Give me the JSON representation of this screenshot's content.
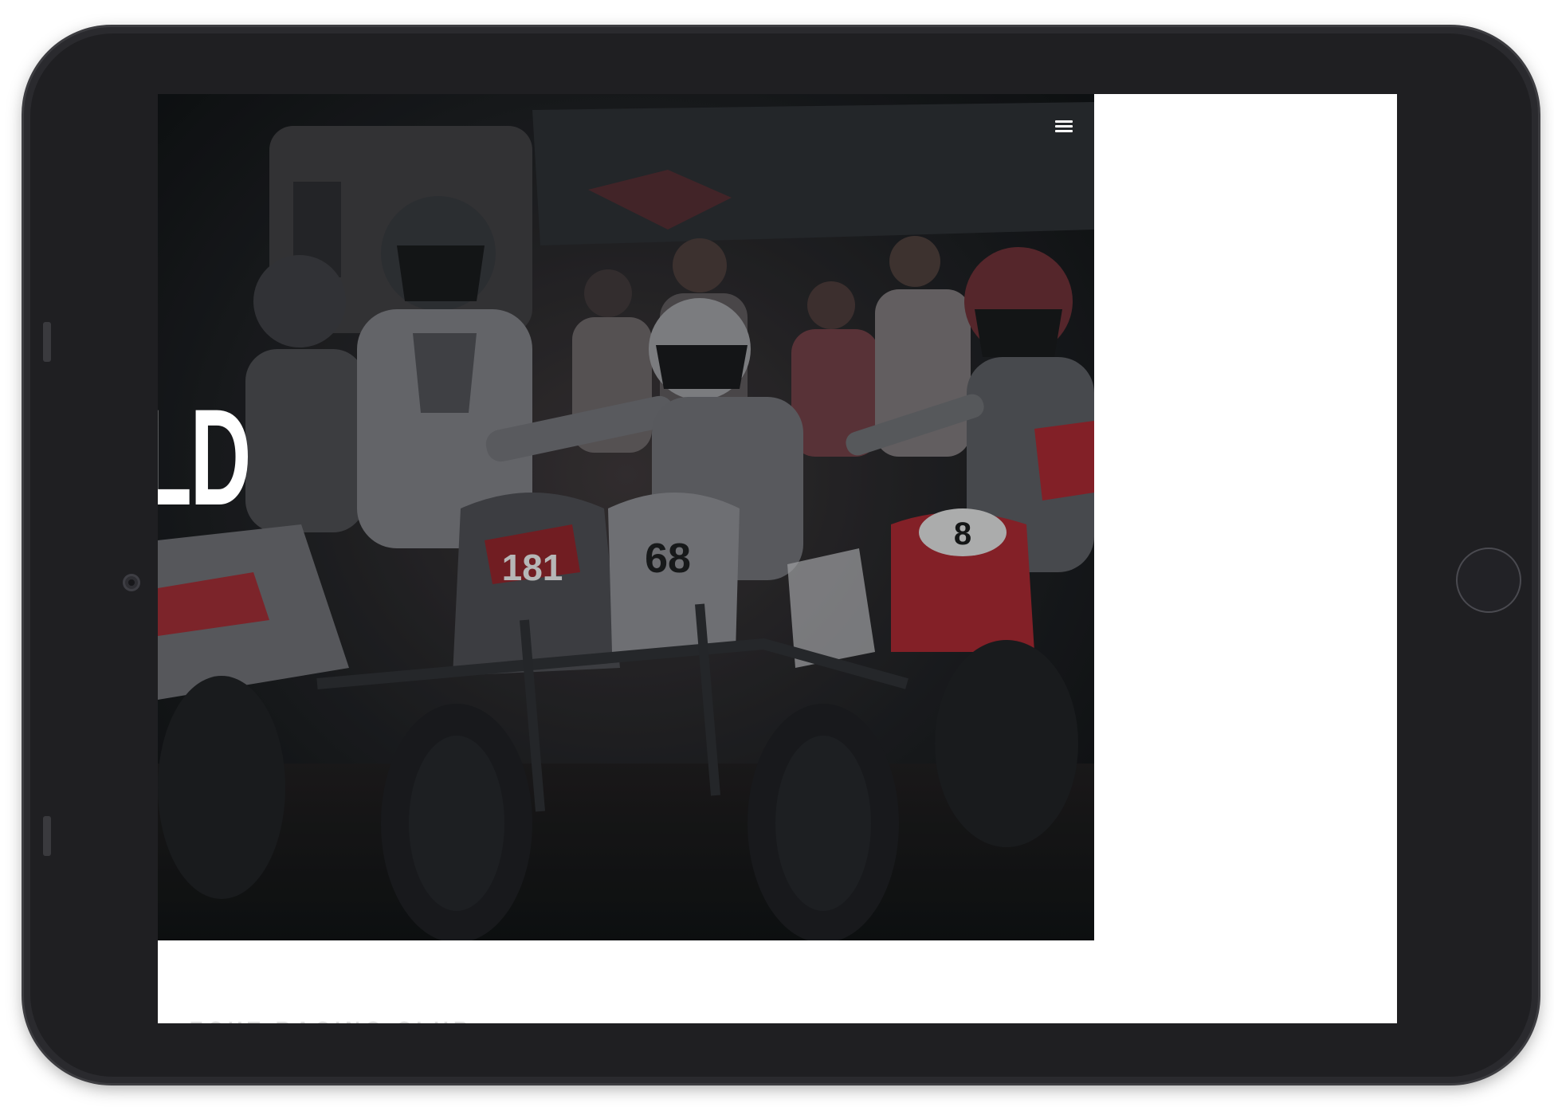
{
  "hero": {
    "title": "IELD",
    "image_description_icon": "atv-racers-photo",
    "rider_numbers": [
      "181",
      "68",
      "8"
    ]
  },
  "nav": {
    "menu_icon": "hamburger-menu-icon"
  },
  "section": {
    "label": "...ECHT RACING CLUB"
  },
  "colors": {
    "device_frame": "#2a2a2e",
    "hero_overlay": "#0f1214",
    "accent_red": "#b3222b",
    "text": "#ffffff",
    "page": "#ffffff"
  }
}
